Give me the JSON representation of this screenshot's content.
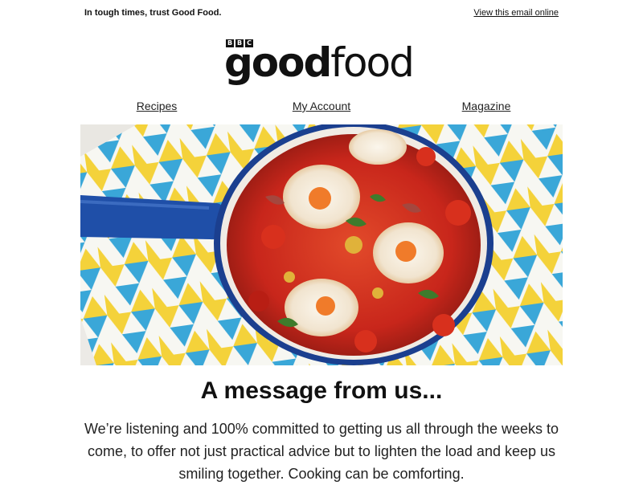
{
  "header": {
    "tagline": "In tough times, trust Good Food.",
    "view_online": "View this email online"
  },
  "logo": {
    "bbc": [
      "B",
      "B",
      "C"
    ],
    "good": "good",
    "food": "food"
  },
  "nav": {
    "items": [
      {
        "label": "Recipes"
      },
      {
        "label": "My Account"
      },
      {
        "label": "Magazine"
      }
    ]
  },
  "hero": {
    "image_label": "Shakshuka pan with eggs on patterned tea towel"
  },
  "message": {
    "headline": "A message from us...",
    "body": "We’re listening and 100% committed to getting us all through the weeks to come, to offer not just practical advice but to lighten the load and keep us smiling together. Cooking can be comforting."
  },
  "colors": {
    "pan_blue": "#1f4fa8",
    "sauce_red": "#c8261b",
    "towel_yellow": "#f4d23a",
    "towel_cyan": "#3aa7d8"
  }
}
